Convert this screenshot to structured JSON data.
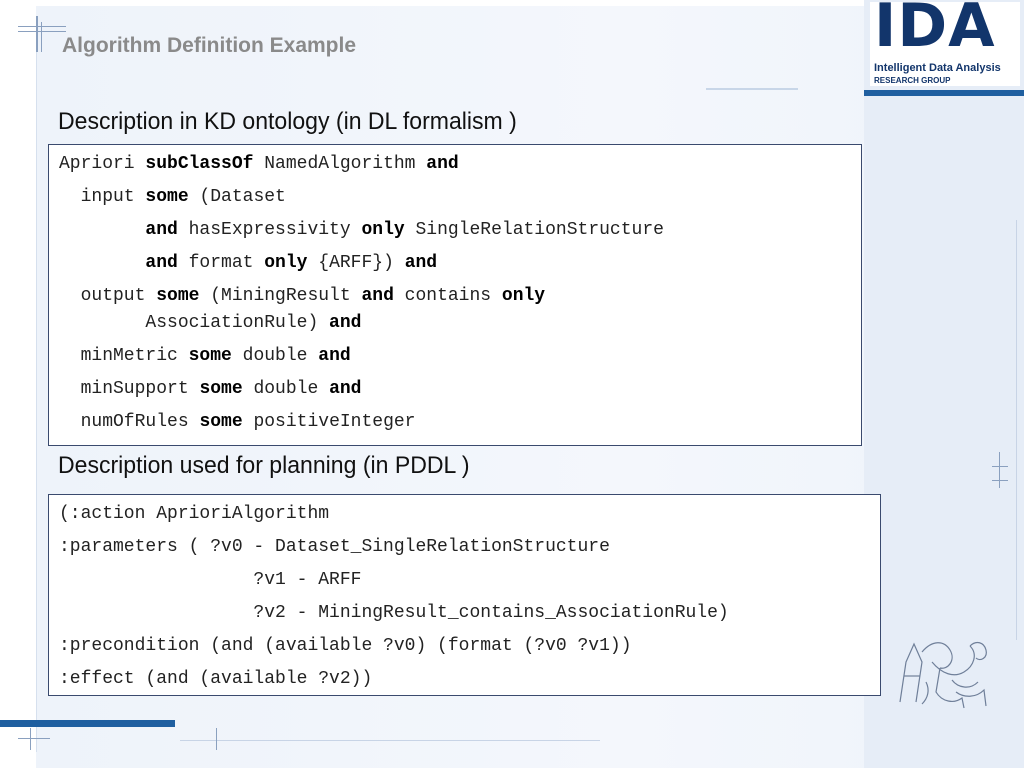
{
  "slide": {
    "title": "Algorithm Definition Example"
  },
  "logo": {
    "main": "IDA",
    "line1": "Intelligent Data Analysis",
    "line2": "RESEARCH GROUP"
  },
  "section1": {
    "heading": "Description in KD ontology  (in DL formalism )",
    "lines": [
      [
        {
          "t": "Apriori "
        },
        {
          "t": "subClassOf",
          "b": true
        },
        {
          "t": " NamedAlgorithm "
        },
        {
          "t": "and",
          "b": true
        }
      ],
      [
        {
          "t": "  input "
        },
        {
          "t": "some",
          "b": true
        },
        {
          "t": " (Dataset"
        }
      ],
      [
        {
          "t": "        "
        },
        {
          "t": "and",
          "b": true
        },
        {
          "t": " hasExpressivity "
        },
        {
          "t": "only",
          "b": true
        },
        {
          "t": " SingleRelationStructure"
        }
      ],
      [
        {
          "t": "        "
        },
        {
          "t": "and",
          "b": true
        },
        {
          "t": " format "
        },
        {
          "t": "only",
          "b": true
        },
        {
          "t": " {ARFF}) "
        },
        {
          "t": "and",
          "b": true
        }
      ],
      [
        {
          "t": "  output "
        },
        {
          "t": "some",
          "b": true
        },
        {
          "t": " (MiningResult "
        },
        {
          "t": "and",
          "b": true
        },
        {
          "t": " contains "
        },
        {
          "t": "only",
          "b": true
        }
      ],
      [
        {
          "t": "        AssociationRule) "
        },
        {
          "t": "and",
          "b": true
        }
      ],
      [
        {
          "t": "  minMetric "
        },
        {
          "t": "some",
          "b": true
        },
        {
          "t": " double "
        },
        {
          "t": "and",
          "b": true
        }
      ],
      [
        {
          "t": "  minSupport "
        },
        {
          "t": "some",
          "b": true
        },
        {
          "t": " double "
        },
        {
          "t": "and",
          "b": true
        }
      ],
      [
        {
          "t": "  numOfRules "
        },
        {
          "t": "some",
          "b": true
        },
        {
          "t": " positiveInteger"
        }
      ]
    ]
  },
  "section2": {
    "heading": "Description used for planning  (in PDDL )",
    "lines": [
      [
        {
          "t": "(:action AprioriAlgorithm"
        }
      ],
      [
        {
          "t": ":parameters ( ?v0 - Dataset_SingleRelationStructure"
        }
      ],
      [
        {
          "t": "                  ?v1 - ARFF"
        }
      ],
      [
        {
          "t": "                  ?v2 - MiningResult_contains_AssociationRule)"
        }
      ],
      [
        {
          "t": ":precondition (and (available ?v0) (format (?v0 ?v1))"
        }
      ],
      [
        {
          "t": ":effect (and (available ?v2))"
        }
      ]
    ]
  },
  "colors": {
    "accent": "#1f5fa0",
    "logo": "#12356b",
    "title": "#8a8a8a"
  }
}
